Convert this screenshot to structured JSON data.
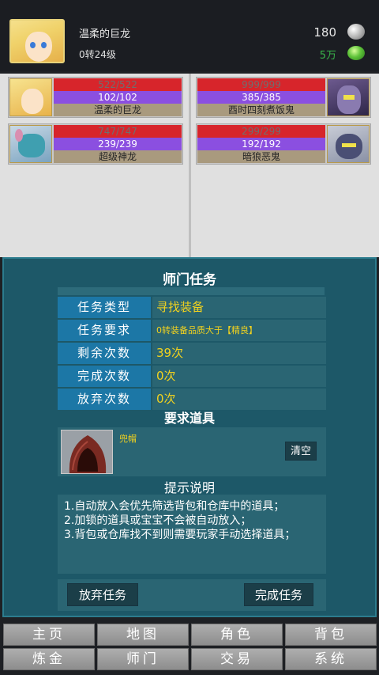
{
  "player": {
    "name": "温柔的巨龙",
    "level": "0转24级",
    "silver": "180",
    "jade": "5万"
  },
  "battle": {
    "allies": [
      {
        "hp": "522/522",
        "mp": "102/102",
        "name": "温柔的巨龙"
      },
      {
        "hp": "747/747",
        "mp": "239/239",
        "name": "超级神龙"
      }
    ],
    "enemies": [
      {
        "hp": "999/999",
        "mp": "385/385",
        "name": "酉时四刻煮饭鬼"
      },
      {
        "hp": "299/299",
        "mp": "192/192",
        "name": "暗狼恶鬼"
      }
    ]
  },
  "quest": {
    "title": "师门任务",
    "rows": [
      {
        "label": "任务类型",
        "value": "寻找装备"
      },
      {
        "label": "任务要求",
        "value": "0转装备品质大于【精良】"
      },
      {
        "label": "剩余次数",
        "value": "39次"
      },
      {
        "label": "完成次数",
        "value": "0次"
      },
      {
        "label": "放弃次数",
        "value": "0次"
      }
    ],
    "required_items_title": "要求道具",
    "item_name": "兜帽",
    "clear_label": "清空",
    "hint_title": "提示说明",
    "hints": [
      "1.自动放入会优先筛选背包和仓库中的道具；",
      "2.加锁的道具或宝宝不会被自动放入；",
      "3.背包或仓库找不到则需要玩家手动选择道具；"
    ],
    "abandon_label": "放弃任务",
    "complete_label": "完成任务"
  },
  "nav": {
    "row1": [
      "主页",
      "地图",
      "角色",
      "背包"
    ],
    "row2": [
      "炼金",
      "师门",
      "交易",
      "系统"
    ]
  }
}
